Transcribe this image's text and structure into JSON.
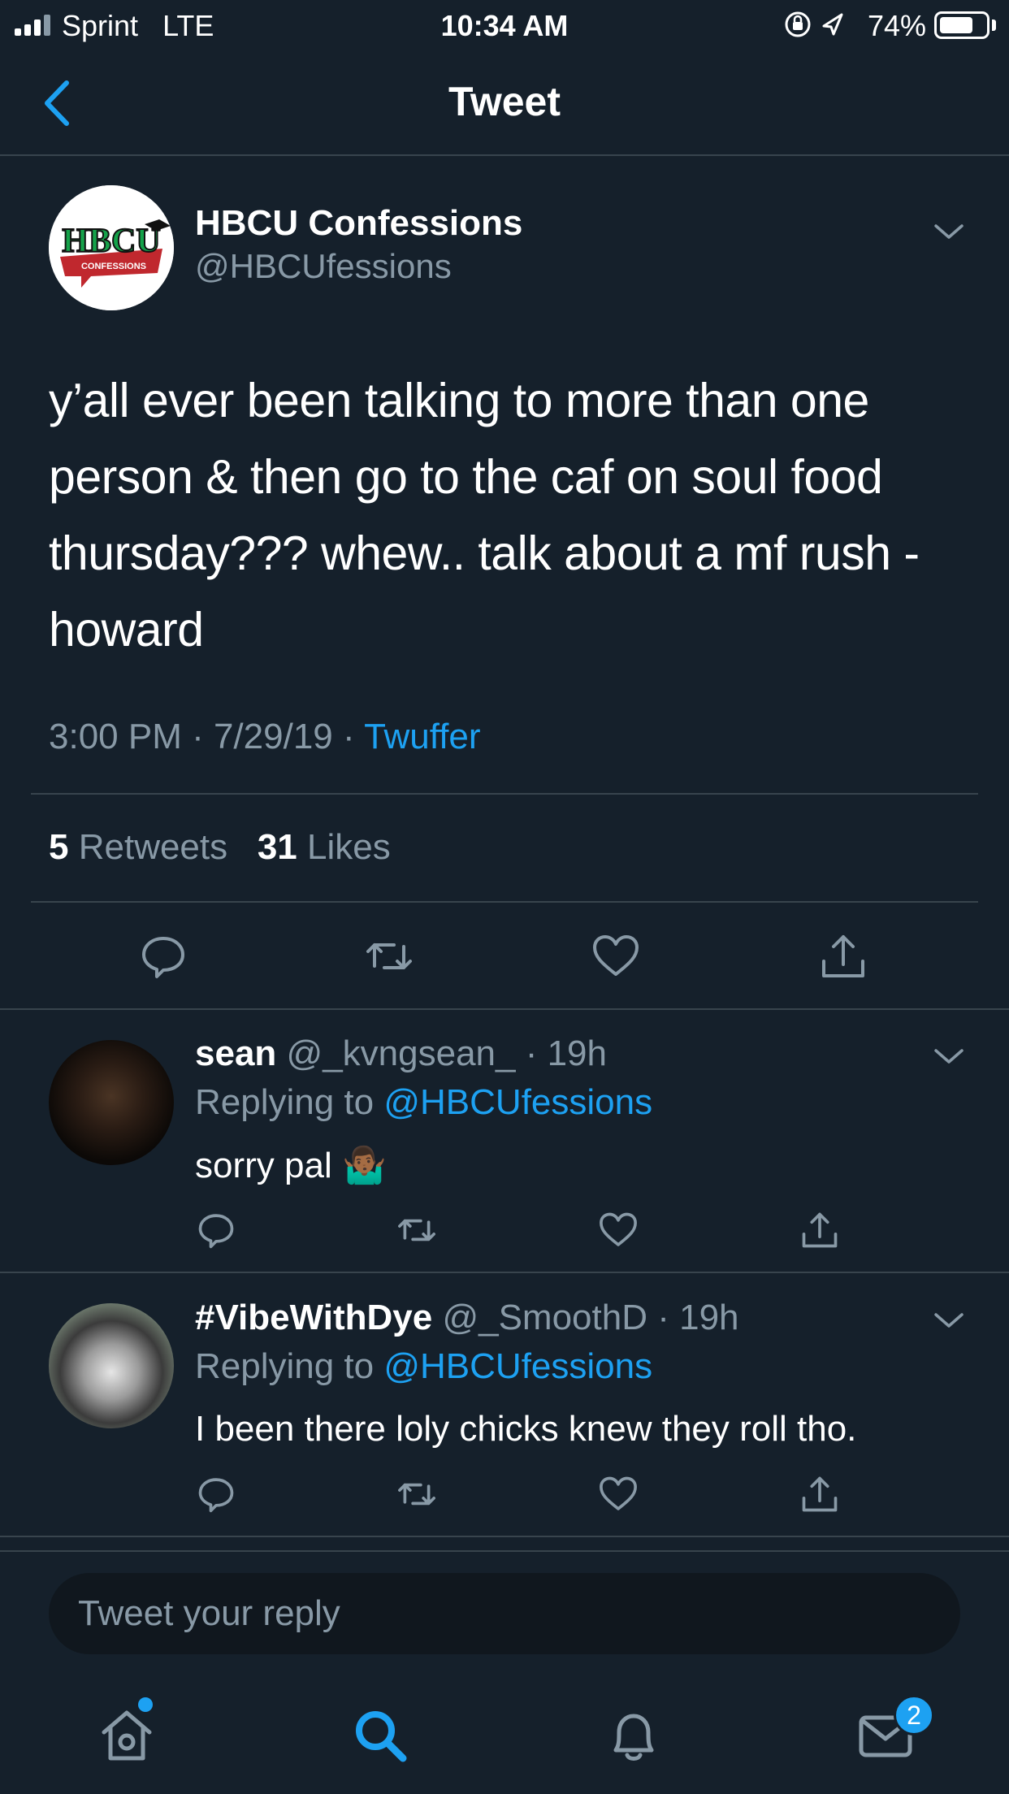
{
  "status_bar": {
    "carrier": "Sprint",
    "network": "LTE",
    "time": "10:34 AM",
    "battery_percent": "74%",
    "battery_level": 0.74
  },
  "nav": {
    "title": "Tweet"
  },
  "tweet": {
    "author_name": "HBCU Confessions",
    "author_handle": "@HBCUfessions",
    "avatar_logo": {
      "wordmark": "HBCU",
      "banner": "CONFESSIONS"
    },
    "text": "y’all ever been talking to more than one person & then go to the caf on soul food thursday??? whew.. talk about a mf rush - howard",
    "time_date": "3:00 PM · 7/29/19 · ",
    "source": "Twuffer",
    "retweet_count": "5",
    "retweet_label": "Retweets",
    "like_count": "31",
    "like_label": "Likes"
  },
  "replies": [
    {
      "name": "sean",
      "handle_time": " @_kvngsean_ · 19h",
      "replying_label": "Replying to ",
      "replying_to": "@HBCUfessions",
      "text": "sorry pal 🤷🏾‍♂️"
    },
    {
      "name": "#VibeWithDye",
      "handle_time": " @_SmoothD · 19h",
      "replying_label": "Replying to ",
      "replying_to": "@HBCUfessions",
      "text": "I been there loly chicks knew they roll tho."
    }
  ],
  "composer": {
    "placeholder": "Tweet your reply"
  },
  "tab_bar": {
    "messages_badge": "2"
  },
  "colors": {
    "background": "#15202b",
    "accent": "#1da1f2",
    "secondary_text": "#8899a6",
    "divider": "#38444d"
  }
}
